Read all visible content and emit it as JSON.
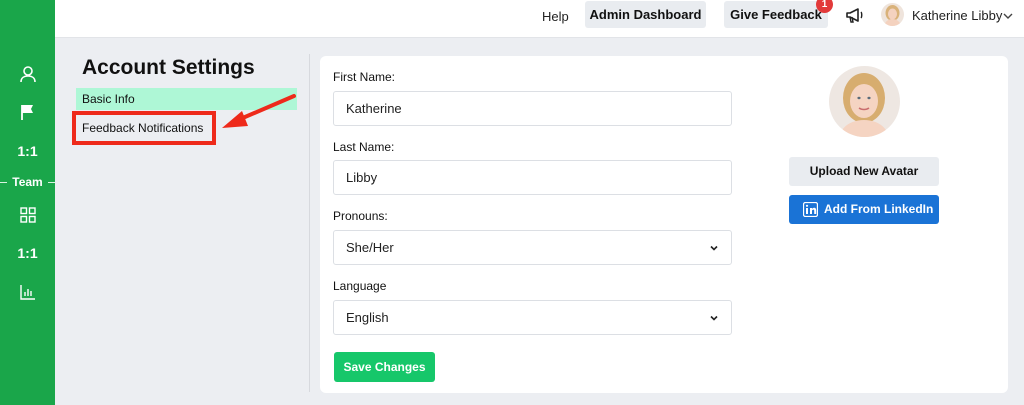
{
  "rail": {
    "items": [
      {
        "icon": "user-icon"
      },
      {
        "icon": "flag-icon"
      },
      {
        "label": "1:1"
      },
      {
        "label": "Team"
      },
      {
        "icon": "grid-icon"
      },
      {
        "label": "1:1"
      },
      {
        "icon": "bar-chart-icon"
      }
    ]
  },
  "topbar": {
    "help": "Help",
    "admin_dashboard": "Admin Dashboard",
    "give_feedback": "Give Feedback",
    "notification_count": "1",
    "user_name": "Katherine Libby"
  },
  "settings": {
    "title": "Account Settings",
    "nav": {
      "basic_info": "Basic Info",
      "feedback_notifications": "Feedback Notifications"
    }
  },
  "form": {
    "first_name_label": "First Name:",
    "first_name_value": "Katherine",
    "last_name_label": "Last Name:",
    "last_name_value": "Libby",
    "pronouns_label": "Pronouns:",
    "pronouns_value": "She/Her",
    "language_label": "Language",
    "language_value": "English",
    "save_label": "Save Changes"
  },
  "avatar": {
    "upload_label": "Upload New Avatar",
    "linkedin_label": "Add From LinkedIn"
  },
  "colors": {
    "rail": "#1aa64a",
    "active_nav": "#aef7d6",
    "save": "#16c76a",
    "linkedin": "#1a73d6",
    "annotation": "#ee2a1b"
  }
}
